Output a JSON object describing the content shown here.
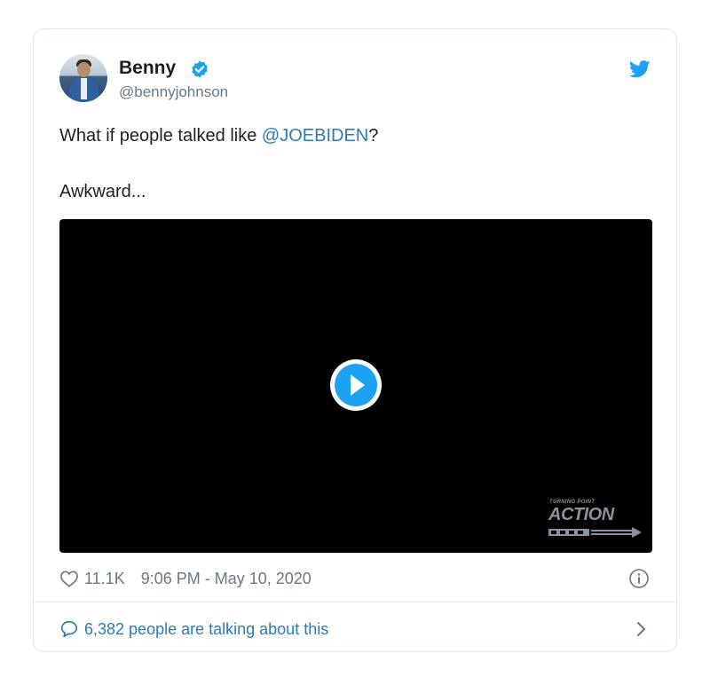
{
  "author": {
    "name": "Benny",
    "handle": "@bennyjohnson",
    "verified": true
  },
  "tweet": {
    "line1_prefix": "What if people talked like ",
    "mention": "@JOEBIDEN",
    "line1_suffix": "?",
    "line2": "Awkward..."
  },
  "video": {
    "watermark_small": "TURNING POINT",
    "watermark_big": "ACTION"
  },
  "meta": {
    "likes": "11.1K",
    "timestamp": "9:06 PM - May 10, 2020"
  },
  "footer": {
    "talking": "6,382 people are talking about this"
  },
  "colors": {
    "link": "#2b7bb9",
    "text": "#1c2022",
    "muted": "#697882",
    "twitter_blue": "#1da1f2"
  },
  "icons": {
    "brand": "twitter-bird-icon",
    "verified": "verified-badge-icon",
    "play": "play-icon",
    "like": "heart-icon",
    "info": "info-icon",
    "reply": "speech-bubble-icon",
    "more": "chevron-right-icon"
  }
}
